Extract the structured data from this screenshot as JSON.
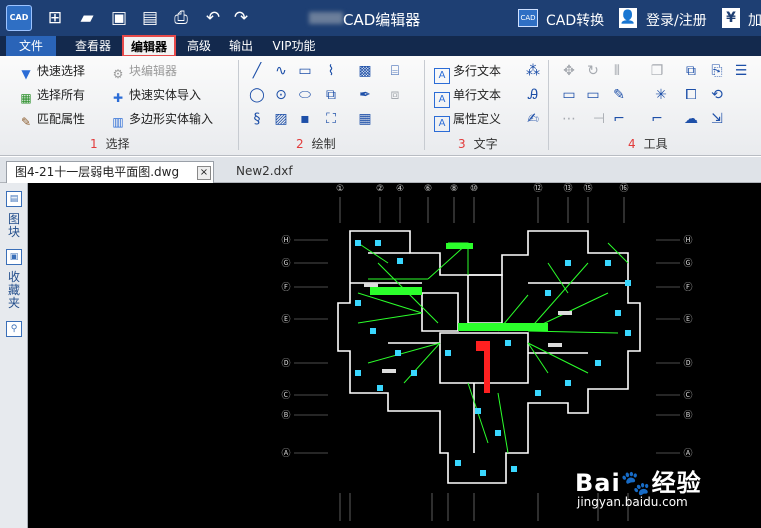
{
  "titlebar": {
    "logo_text": "CAD",
    "app_title": "CAD编辑器",
    "cad_convert": "CAD转换",
    "cad_convert_icon_text": "CAD",
    "login": "登录/注册",
    "yen": "¥",
    "more": "加",
    "icons": [
      "new-icon",
      "open-folder-icon",
      "save-icon",
      "save-as-icon",
      "print-icon",
      "undo-icon",
      "redo-icon"
    ]
  },
  "menu": {
    "file": "文件",
    "viewer": "查看器",
    "editor": "编辑器",
    "advanced": "高级",
    "output": "输出",
    "vip": "VIP功能"
  },
  "ribbon": {
    "select": {
      "quick_select": "快速选择",
      "select_all": "选择所有",
      "match_props": "匹配属性",
      "block_editor": "块编辑器",
      "quick_entity_import": "快速实体导入",
      "polygon_entity_input": "多边形实体输入",
      "num": "1",
      "label": "选择"
    },
    "draw": {
      "num": "2",
      "label": "绘制"
    },
    "text": {
      "mtext": "多行文本",
      "stext": "单行文本",
      "attdef": "属性定义",
      "num": "3",
      "label": "文字"
    },
    "tools": {
      "num": "4",
      "label": "工具"
    }
  },
  "tabs": {
    "active": "图4-21十一层弱电平面图.dwg",
    "close": "×",
    "second": "New2.dxf"
  },
  "sidepanel": {
    "layers": "图块",
    "favorites": "收藏夹"
  },
  "drawing": {
    "top_marks": [
      "①",
      "②",
      "④",
      "⑥",
      "⑧",
      "⑩",
      "⑫",
      "⑬",
      "⑮",
      "⑯"
    ],
    "left_marks": [
      "Ⓗ",
      "Ⓖ",
      "Ⓕ",
      "Ⓔ",
      "Ⓓ",
      "Ⓒ",
      "Ⓑ",
      "Ⓐ"
    ],
    "colors": {
      "background": "#000000",
      "wall": "#ffffff",
      "wire": "#2bff2b",
      "device": "#3ad7ff",
      "highlight": "#ff2020"
    }
  },
  "watermark": {
    "main": "Bai🐾经验",
    "sub": "jingyan.baidu.com"
  },
  "colors": {
    "titlebar": "#1e3f73",
    "menubar": "#13294d",
    "file_menu": "#2a64b8",
    "active_outline": "#e64a4a",
    "group_number": "#e23b3b"
  }
}
